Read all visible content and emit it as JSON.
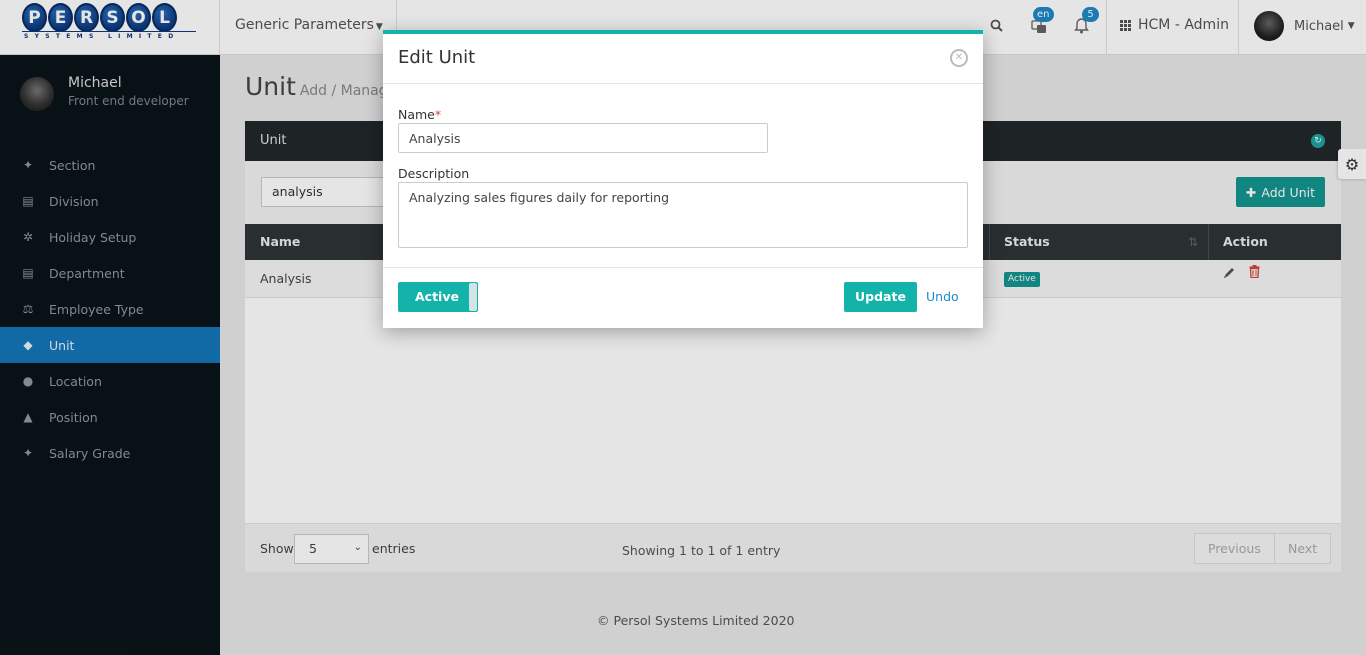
{
  "topbar": {
    "logo_letters": [
      "P",
      "E",
      "R",
      "S",
      "O",
      "L"
    ],
    "logo_sub": "SYSTEMS LIMITED",
    "module_menu": "Generic Parameters",
    "lang_badge": "en",
    "notif_count": "5",
    "app_name": "HCM - Admin",
    "user_name": "Michael"
  },
  "sidebar": {
    "user_name": "Michael",
    "user_role": "Front end developer",
    "items": [
      {
        "label": "Section",
        "icon": "pin-icon"
      },
      {
        "label": "Division",
        "icon": "building-icon"
      },
      {
        "label": "Holiday Setup",
        "icon": "tree-icon"
      },
      {
        "label": "Department",
        "icon": "building-icon"
      },
      {
        "label": "Employee Type",
        "icon": "balance-scale-icon"
      },
      {
        "label": "Unit",
        "icon": "tags-icon",
        "active": true
      },
      {
        "label": "Location",
        "icon": "map-pin-icon"
      },
      {
        "label": "Position",
        "icon": "graduation-cap-icon"
      },
      {
        "label": "Salary Grade",
        "icon": "pin-icon"
      }
    ]
  },
  "page": {
    "title": "Unit",
    "subtitle": "Add / Manage"
  },
  "panel": {
    "title": "Unit",
    "search_value": "analysis",
    "add_button": "Add Unit",
    "columns": [
      "Name",
      "Status",
      "Action"
    ],
    "rows": [
      {
        "name": "Analysis",
        "status": "Active"
      }
    ],
    "show_label": "Show",
    "page_size": "5",
    "entries_label": "entries",
    "showing": "Showing 1 to 1 of 1 entry",
    "prev": "Previous",
    "next": "Next"
  },
  "footer": "© Persol Systems Limited 2020",
  "modal": {
    "title": "Edit Unit",
    "name_label": "Name",
    "required_mark": "*",
    "name_value": "Analysis",
    "description_label": "Description",
    "description_value": "Analyzing sales figures daily for reporting",
    "toggle_label": "Active",
    "update_button": "Update",
    "undo_link": "Undo"
  },
  "colors": {
    "accent": "#14b3aa",
    "sidebar_active": "#1377b8",
    "sidebar_bg": "#0a1419",
    "delete": "#d9433b"
  }
}
